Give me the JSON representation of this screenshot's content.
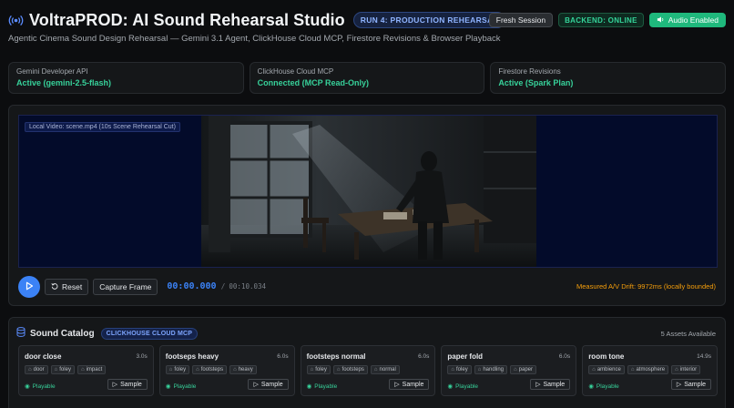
{
  "header": {
    "title": "VoltraPROD: AI Sound Rehearsal Studio",
    "run_badge": "RUN 4: PRODUCTION REHEARSAL",
    "subtitle": "Agentic Cinema Sound Design Rehearsal — Gemini 3.1 Agent, ClickHouse Cloud MCP, Firestore Revisions & Browser Playback",
    "fresh_session_label": "Fresh Session",
    "backend_status": "BACKEND: ONLINE",
    "audio_label": "Audio Enabled",
    "icons": {
      "logo": "broadcast-icon",
      "audio": "speaker-icon"
    }
  },
  "status_cards": [
    {
      "label": "Gemini Developer API",
      "value": "Active (gemini-2.5-flash)"
    },
    {
      "label": "ClickHouse Cloud MCP",
      "value": "Connected (MCP Read-Only)"
    },
    {
      "label": "Firestore Revisions",
      "value": "Active (Spark Plan)"
    }
  ],
  "player": {
    "video_label": "Local Video: scene.mp4 (10s Scene Rehearsal Cut)",
    "reset_label": "Reset",
    "capture_label": "Capture Frame",
    "current_time": "00:00.000",
    "separator": "/",
    "total_time": "00:10.034",
    "drift_text": "Measured A/V Drift: 9972ms (locally bounded)"
  },
  "catalog": {
    "title": "Sound Catalog",
    "badge": "CLICKHOUSE CLOUD MCP",
    "count_text": "5 Assets Available",
    "assets": [
      {
        "name": "door close",
        "duration": "3.0s",
        "tags": [
          "door",
          "foley",
          "impact"
        ],
        "status": "Playable",
        "action": "Sample"
      },
      {
        "name": "footseps heavy",
        "duration": "6.0s",
        "tags": [
          "foley",
          "footsteps",
          "heavy"
        ],
        "status": "Playable",
        "action": "Sample"
      },
      {
        "name": "footsteps normal",
        "duration": "6.0s",
        "tags": [
          "foley",
          "footsteps",
          "normal"
        ],
        "status": "Playable",
        "action": "Sample"
      },
      {
        "name": "paper fold",
        "duration": "6.0s",
        "tags": [
          "foley",
          "handling",
          "paper"
        ],
        "status": "Playable",
        "action": "Sample"
      },
      {
        "name": "room tone",
        "duration": "14.9s",
        "tags": [
          "ambience",
          "atmosphere",
          "interior"
        ],
        "status": "Playable",
        "action": "Sample"
      }
    ]
  },
  "colors": {
    "accent_blue": "#3b82f6",
    "success_green": "#37d19a",
    "warning_orange": "#f59e0b",
    "audio_button": "#1fb87c"
  }
}
